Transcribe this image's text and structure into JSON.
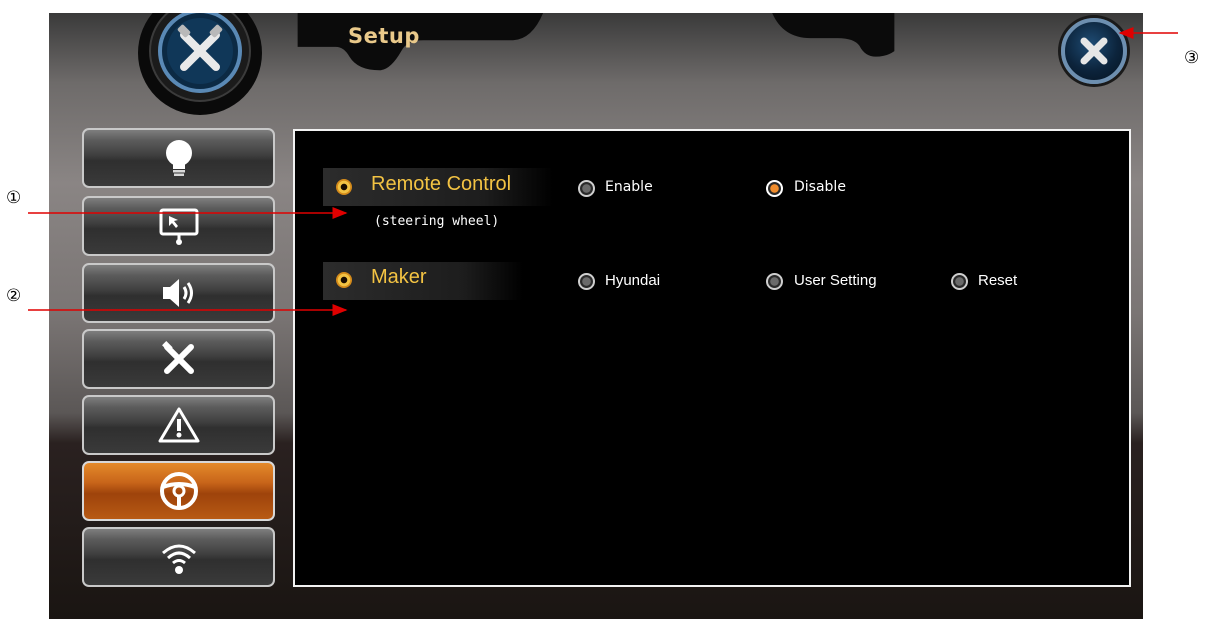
{
  "header": {
    "title": "Setup",
    "close_icon": "close-icon",
    "logo_icon": "tools-icon"
  },
  "sidebar": {
    "items": [
      {
        "icon": "lightbulb-icon",
        "active": false
      },
      {
        "icon": "display-icon",
        "active": false
      },
      {
        "icon": "speaker-icon",
        "active": false
      },
      {
        "icon": "tools-icon",
        "active": false
      },
      {
        "icon": "warning-icon",
        "active": false
      },
      {
        "icon": "steering-wheel-icon",
        "active": true
      },
      {
        "icon": "wifi-icon",
        "active": false
      }
    ]
  },
  "panel": {
    "remote_control": {
      "label": "Remote Control",
      "sublabel": "(steering wheel)",
      "options": [
        {
          "label": "Enable",
          "checked": false
        },
        {
          "label": "Disable",
          "checked": true
        }
      ]
    },
    "maker": {
      "label": "Maker",
      "options": [
        {
          "label": "Hyundai",
          "checked": false
        },
        {
          "label": "User Setting",
          "checked": false
        },
        {
          "label": "Reset",
          "checked": false
        }
      ]
    }
  },
  "annotations": {
    "callout_1": "①",
    "callout_2": "②",
    "callout_3": "③"
  },
  "colors": {
    "accent": "#f08c2c",
    "label": "#f3c343",
    "annotation_arrow": "#e00000"
  }
}
